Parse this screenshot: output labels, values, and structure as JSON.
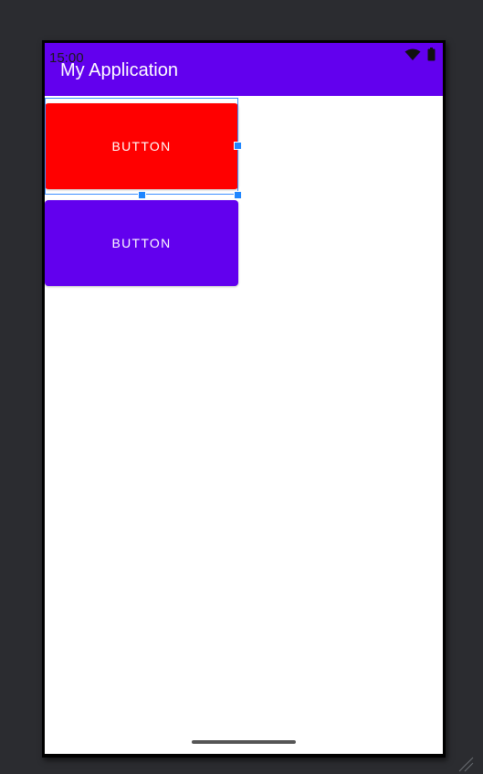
{
  "status_bar": {
    "time": "15:00",
    "wifi_icon": "wifi-icon",
    "battery_icon": "battery-icon"
  },
  "app_bar": {
    "title": "My Application",
    "color": "#6200ee"
  },
  "buttons": [
    {
      "label": "BUTTON",
      "color": "#ff0000",
      "selected": true
    },
    {
      "label": "BUTTON",
      "color": "#6200ee",
      "selected": false
    }
  ],
  "selection": {
    "color": "#1f86ff"
  }
}
